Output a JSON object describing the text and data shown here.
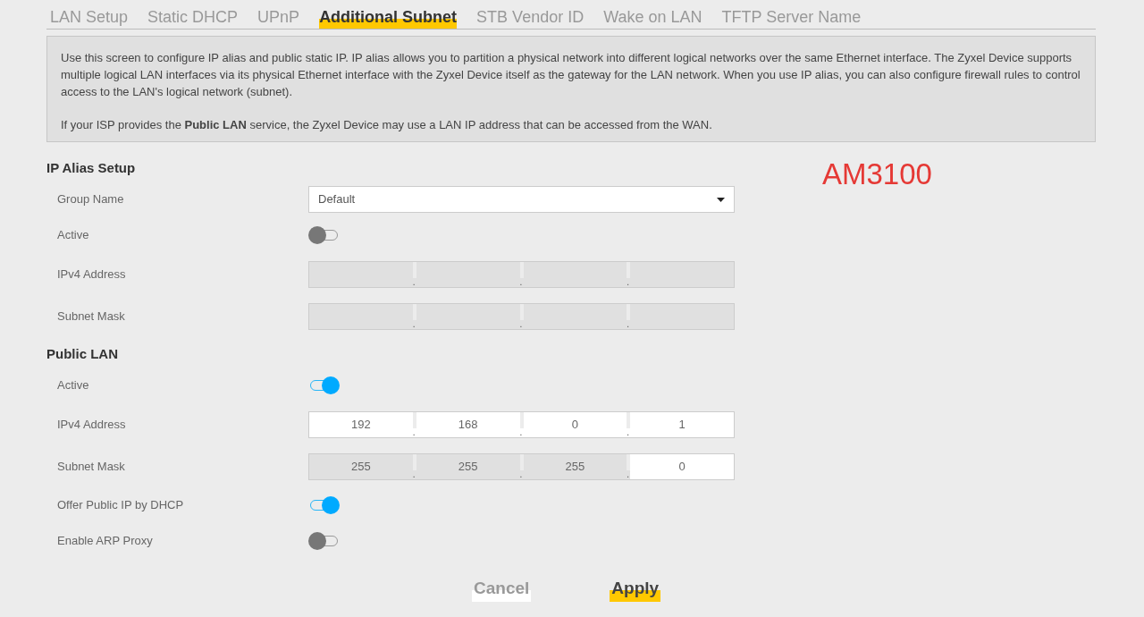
{
  "tabs": [
    {
      "label": "LAN Setup",
      "selected": false
    },
    {
      "label": "Static DHCP",
      "selected": false
    },
    {
      "label": "UPnP",
      "selected": false
    },
    {
      "label": "Additional Subnet",
      "selected": true
    },
    {
      "label": "STB Vendor ID",
      "selected": false
    },
    {
      "label": "Wake on LAN",
      "selected": false
    },
    {
      "label": "TFTP Server Name",
      "selected": false
    }
  ],
  "description": [
    "Use this screen to configure IP alias and public static IP. IP alias allows you to partition a physical network into different logical networks over the same Ethernet interface. The Zyxel Device supports multiple logical LAN interfaces via its physical Ethernet interface with the Zyxel Device itself as the gateway for the LAN network. When you use IP alias, you can also configure firewall rules to control access to the LAN's logical network (subnet).",
    "If your ISP provides the **Public LAN** service, the Zyxel Device may use a LAN IP address that can be accessed from the WAN."
  ],
  "annotation": "AM3100",
  "sections": [
    {
      "title": "IP Alias Setup",
      "rows": [
        {
          "kind": "select",
          "label": "Group Name",
          "value": "Default"
        },
        {
          "kind": "toggle",
          "label": "Active",
          "on": false
        },
        {
          "kind": "ip",
          "label": "IPv4 Address",
          "separator": ".",
          "octets": [
            {
              "disabled": true
            },
            {
              "disabled": true
            },
            {
              "disabled": true
            },
            {
              "disabled": true
            }
          ]
        },
        {
          "kind": "ip",
          "label": "Subnet Mask",
          "separator": ".",
          "octets": [
            {
              "disabled": true
            },
            {
              "disabled": true
            },
            {
              "disabled": true
            },
            {
              "disabled": true
            }
          ]
        }
      ]
    },
    {
      "title": "Public LAN",
      "rows": [
        {
          "kind": "toggle",
          "label": "Active",
          "on": true
        },
        {
          "kind": "ip",
          "label": "IPv4 Address",
          "separator": ".",
          "octets": [
            {
              "value": "192",
              "disabled": false
            },
            {
              "value": "168",
              "disabled": false
            },
            {
              "value": "0",
              "disabled": false
            },
            {
              "value": "1",
              "disabled": false
            }
          ]
        },
        {
          "kind": "ip",
          "label": "Subnet Mask",
          "separator": ".",
          "octets": [
            {
              "value": "255",
              "disabled": true
            },
            {
              "value": "255",
              "disabled": true
            },
            {
              "value": "255",
              "disabled": true
            },
            {
              "value": "0",
              "disabled": false
            }
          ]
        },
        {
          "kind": "toggle",
          "label": "Offer Public IP by DHCP",
          "on": true
        },
        {
          "kind": "toggle",
          "label": "Enable ARP Proxy",
          "on": false
        }
      ]
    }
  ],
  "buttons": [
    {
      "kind": "cancel",
      "label": "Cancel"
    },
    {
      "kind": "apply",
      "label": "Apply"
    }
  ]
}
